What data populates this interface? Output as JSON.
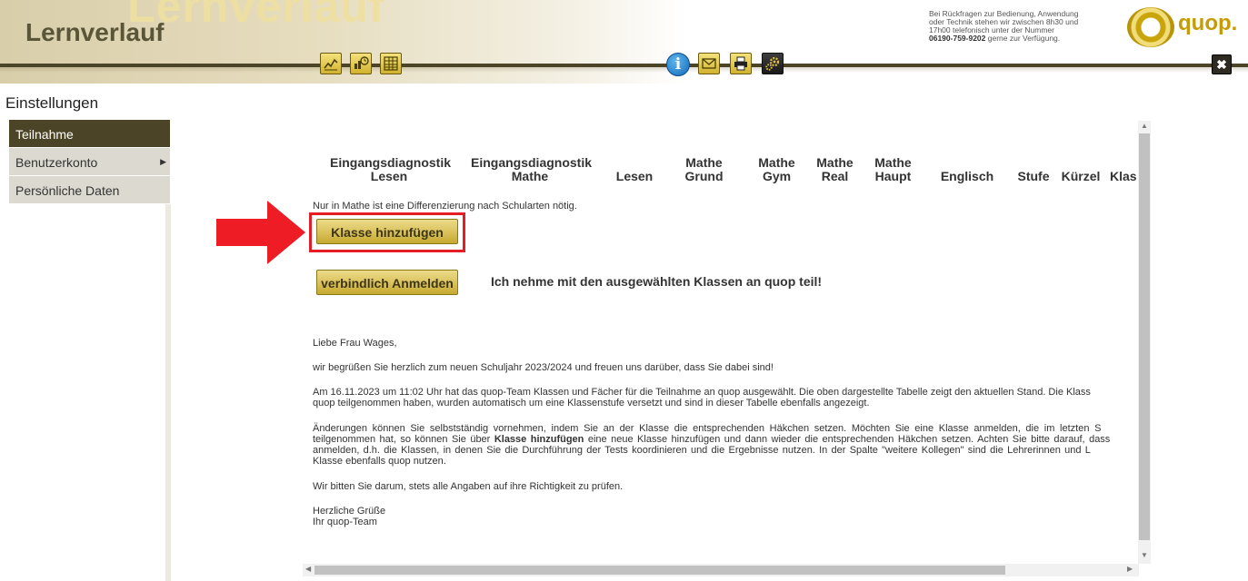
{
  "header": {
    "watermark": "Lernverlauf",
    "title": "Lernverlauf",
    "support_line1": "Bei Rückfragen zur Bedienung, Anwendung",
    "support_line2": "oder Technik stehen wir zwischen 8h30 und",
    "support_line3": "17h00 telefonisch unter der Nummer",
    "support_phone": "06190-759-9202",
    "support_tail": " gerne zur Verfügung.",
    "logo_text": "quop.",
    "close_label": "✖",
    "toolbar_icons": [
      "chart-line-icon",
      "chart-clock-icon",
      "calendar-table-icon"
    ],
    "tool_icons": [
      "info-icon",
      "mail-icon",
      "print-icon",
      "settings-icon"
    ]
  },
  "sidebar": {
    "section_title": "Einstellungen",
    "items": [
      {
        "label": "Teilnahme",
        "active": true
      },
      {
        "label": "Benutzerkonto",
        "arrow": "▶"
      },
      {
        "label": "Persönliche Daten"
      }
    ]
  },
  "table": {
    "columns": [
      {
        "line1": "Eingangsdiagnostik",
        "line2": "Lesen"
      },
      {
        "line1": "Eingangsdiagnostik",
        "line2": "Mathe"
      },
      {
        "line1": "",
        "line2": "Lesen"
      },
      {
        "line1": "Mathe",
        "line2": "Grund"
      },
      {
        "line1": "Mathe",
        "line2": "Gym"
      },
      {
        "line1": "Mathe",
        "line2": "Real"
      },
      {
        "line1": "Mathe",
        "line2": "Haupt"
      },
      {
        "line1": "",
        "line2": "Englisch"
      },
      {
        "line1": "",
        "line2": "Stufe"
      },
      {
        "line1": "",
        "line2": "Kürzel"
      },
      {
        "line1": "",
        "line2": "Klas"
      }
    ],
    "note": "Nur in Mathe ist eine Differenzierung nach Schularten nötig."
  },
  "actions": {
    "add_class": "Klasse hinzufügen",
    "register": "verbindlich Anmelden",
    "commit_text": "Ich nehme mit den ausgewählten Klassen an quop teil!"
  },
  "letter": {
    "greeting": "Liebe Frau Wages,",
    "p1": "wir begrüßen Sie herzlich zum neuen Schuljahr 2023/2024 und freuen uns darüber, dass Sie dabei sind!",
    "p2": "Am 16.11.2023 um 11:02 Uhr hat das quop-Team Klassen und Fächer für die Teilnahme an quop ausgewählt. Die oben dargestellte Tabelle zeigt den aktuellen Stand. Die Klass",
    "p2b": "quop teilgenommen haben, wurden automatisch um eine Klassenstufe versetzt und sind in dieser Tabelle ebenfalls angezeigt.",
    "p3a": "Änderungen können Sie selbstständig vornehmen, indem Sie an der Klasse die entsprechenden Häkchen setzen. Möchten Sie eine Klasse anmelden, die im letzten S",
    "p3b_pre": "teilgenommen hat, so können Sie über ",
    "p3b_bold": "Klasse hinzufügen",
    "p3b_post": " eine neue Klasse hinzufügen und dann wieder die entsprechenden Häkchen setzen. Achten Sie bitte darauf, dass",
    "p3c": "anmelden, d.h. die Klassen, in denen Sie die Durchführung der Tests koordinieren und die Ergebnisse nutzen. In der Spalte \"weitere Kollegen\" sind die Lehrerinnen und L",
    "p3d": "Klasse ebenfalls quop nutzen.",
    "p4": "Wir bitten Sie darum, stets alle Angaben auf ihre Richtigkeit zu prüfen.",
    "closing1": "Herzliche Grüße",
    "closing2": "Ihr quop-Team"
  }
}
